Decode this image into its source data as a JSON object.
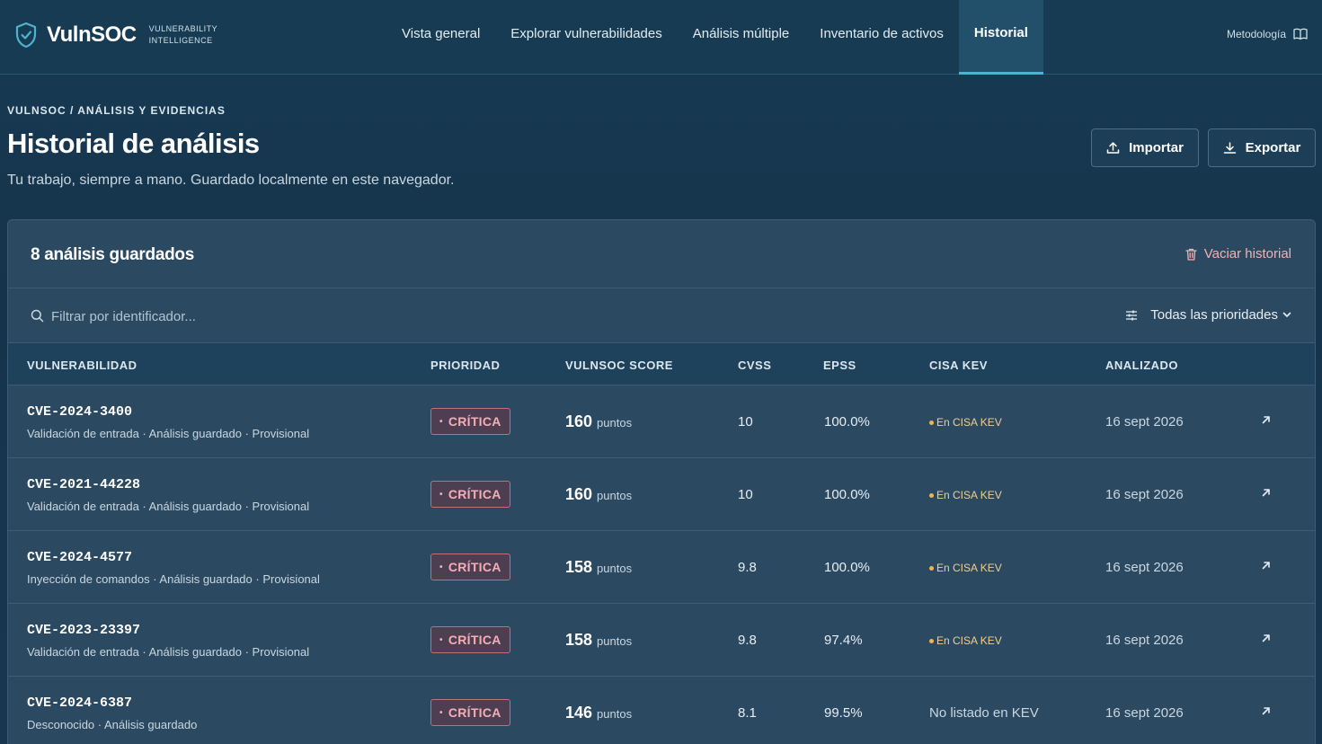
{
  "header": {
    "brand": "VulnSOC",
    "brand_sub_line1": "VULNERABILITY",
    "brand_sub_line2": "INTELLIGENCE",
    "nav": [
      {
        "label": "Vista general",
        "active": false
      },
      {
        "label": "Explorar vulnerabilidades",
        "active": false
      },
      {
        "label": "Análisis múltiple",
        "active": false
      },
      {
        "label": "Inventario de activos",
        "active": false
      },
      {
        "label": "Historial",
        "active": true
      }
    ],
    "methodology": "Metodología"
  },
  "page": {
    "breadcrumb": "VULNSOC / ANÁLISIS Y EVIDENCIAS",
    "title": "Historial de análisis",
    "subtitle": "Tu trabajo, siempre a mano. Guardado localmente en este navegador.",
    "import_label": "Importar",
    "export_label": "Exportar"
  },
  "panel": {
    "count_title": "8 análisis guardados",
    "clear_label": "Vaciar historial",
    "search_placeholder": "Filtrar por identificador...",
    "priority_filter": "Todas las prioridades",
    "columns": [
      "VULNERABILIDAD",
      "PRIORIDAD",
      "VULNSOC SCORE",
      "CVSS",
      "EPSS",
      "CISA KEV",
      "ANALIZADO"
    ],
    "rows": [
      {
        "id": "CVE-2024-3400",
        "meta": "Validación de entrada · Análisis guardado · Provisional",
        "priority": "CRÍTICA",
        "score": "160",
        "score_unit": "puntos",
        "cvss": "10",
        "epss": "100.0%",
        "kev": "En CISA KEV",
        "kev_listed": true,
        "date": "16 sept 2026"
      },
      {
        "id": "CVE-2021-44228",
        "meta": "Validación de entrada · Análisis guardado · Provisional",
        "priority": "CRÍTICA",
        "score": "160",
        "score_unit": "puntos",
        "cvss": "10",
        "epss": "100.0%",
        "kev": "En CISA KEV",
        "kev_listed": true,
        "date": "16 sept 2026"
      },
      {
        "id": "CVE-2024-4577",
        "meta": "Inyección de comandos · Análisis guardado · Provisional",
        "priority": "CRÍTICA",
        "score": "158",
        "score_unit": "puntos",
        "cvss": "9.8",
        "epss": "100.0%",
        "kev": "En CISA KEV",
        "kev_listed": true,
        "date": "16 sept 2026"
      },
      {
        "id": "CVE-2023-23397",
        "meta": "Validación de entrada · Análisis guardado · Provisional",
        "priority": "CRÍTICA",
        "score": "158",
        "score_unit": "puntos",
        "cvss": "9.8",
        "epss": "97.4%",
        "kev": "En CISA KEV",
        "kev_listed": true,
        "date": "16 sept 2026"
      },
      {
        "id": "CVE-2024-6387",
        "meta": "Desconocido · Análisis guardado",
        "priority": "CRÍTICA",
        "score": "146",
        "score_unit": "puntos",
        "cvss": "8.1",
        "epss": "99.5%",
        "kev": "No listado en KEV",
        "kev_listed": false,
        "date": "16 sept 2026"
      }
    ]
  },
  "colors": {
    "accent": "#4fb3cf",
    "critical": "#f6aeb5",
    "kev": "#f0cf8e",
    "danger": "#f1b2b2"
  },
  "icons": [
    "shield-check-icon",
    "book-open-icon",
    "upload-icon",
    "download-icon",
    "trash-icon",
    "search-icon",
    "sliders-icon",
    "chevron-down-icon",
    "arrow-up-right-icon"
  ]
}
